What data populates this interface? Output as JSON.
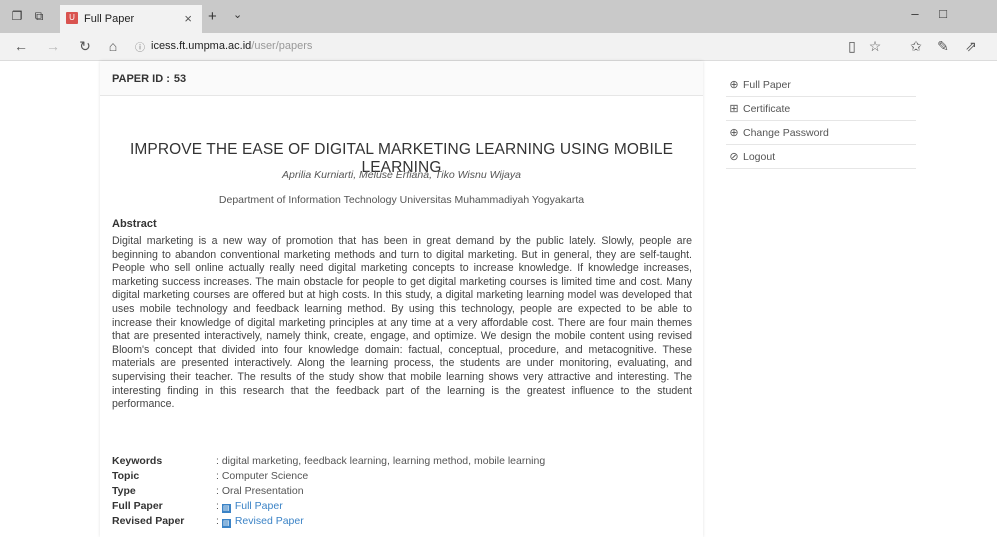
{
  "browser": {
    "tab_title": "Full Paper",
    "tab_favicon": "U",
    "url_host": "icess.ft.umpma.ac.id",
    "url_path": "/user/papers"
  },
  "paper": {
    "id_label": "PAPER ID :",
    "id_value": "53",
    "title": "IMPROVE THE EASE OF DIGITAL MARKETING LEARNING USING MOBILE LEARNING",
    "authors": "Aprilia Kurniarti, Meluse Erfiana, Tiko Wisnu Wijaya",
    "affiliation": "Department of Information Technology Universitas Muhammadiyah Yogyakarta",
    "abstract_heading": "Abstract",
    "abstract": "Digital marketing is a new way of promotion that has been in great demand by the public lately. Slowly, people are beginning to abandon conventional marketing methods and turn to digital marketing. But in general, they are self-taught. People who sell online actually really need digital marketing concepts to increase knowledge. If knowledge increases, marketing success increases. The main obstacle for people to get digital marketing courses is limited time and cost. Many digital marketing courses are offered but at high costs. In this study, a digital marketing learning model was developed that uses mobile technology and feedback learning method. By using this technology, people are expected to be able to increase their knowledge of digital marketing principles at any time at a very affordable cost. There are four main themes that are presented interactively, namely think, create, engage, and optimize. We design the mobile content using revised Bloom's concept that divided into four knowledge domain: factual, conceptual, procedure, and metacognitive. These materials are presented interactively. Along the learning process, the students are under monitoring, evaluating, and supervising their teacher. The results of the study show that mobile learning shows very attractive and interesting. The interesting finding in this research that the feedback part of the learning is the greatest influence to the student performance.",
    "meta": {
      "keywords_label": "Keywords",
      "keywords": ": digital marketing, feedback learning, learning method, mobile learning",
      "topic_label": "Topic",
      "topic": ": Computer Science",
      "type_label": "Type",
      "type": ": Oral Presentation",
      "full_paper_label": "Full Paper",
      "full_paper_link": "Full Paper",
      "revised_paper_label": "Revised Paper",
      "revised_paper_link": "Revised Paper",
      "sep": ":"
    }
  },
  "sidebar": {
    "items": [
      {
        "label": "Full Paper",
        "icon": "circle-arrow-icon"
      },
      {
        "label": "Certificate",
        "icon": "certificate-icon"
      },
      {
        "label": "Change Password",
        "icon": "circle-arrow-icon"
      },
      {
        "label": "Logout",
        "icon": "logout-icon"
      }
    ]
  }
}
